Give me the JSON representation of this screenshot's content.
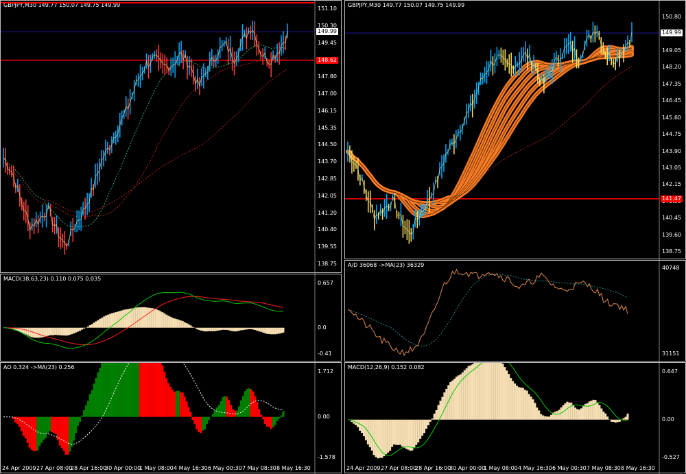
{
  "colors": {
    "background": "#000000",
    "frame": "#c0c0c0",
    "grid": "#303030",
    "price_line": "#1a1aa0",
    "h_line_red": "#ff0000",
    "candle_up": "#00aaff",
    "candle_dn": "#ff4040",
    "orange": "#ff7f27",
    "dashed_red": "#b22222",
    "dashed_green": "#3cb371",
    "bisque": "#f5deb3",
    "ad_line": "#e08a4a",
    "macd_green": "#00c800",
    "macd_red": "#ff2020",
    "ao_up": "#008000",
    "ao_dn": "#ff0000"
  },
  "left": {
    "main": {
      "header": "GBPJPY,M30  149.77 150.07 149.75 149.99",
      "price_axis": [
        "151.10",
        "150.30",
        "149.45",
        "148.65",
        "147.80",
        "147.00",
        "146.15",
        "145.35",
        "144.50",
        "143.70",
        "142.85",
        "142.05",
        "141.20",
        "140.40",
        "139.55",
        "138.75"
      ],
      "current_price_tag": "149.99",
      "red_line_tag": "148.62",
      "top_tag": "151.10"
    },
    "macd": {
      "header": "MACD(38,63,23) 0.110 0.075 0.035",
      "axis": [
        "0.657",
        "0.0",
        "-0.41"
      ]
    },
    "ao": {
      "header": "AO 0.324  ->MA(23) 0.256",
      "axis": [
        "1.712",
        "0.00",
        "-1.578"
      ]
    },
    "x_axis": [
      "24 Apr 2009",
      "27 Apr 08:00",
      "28 Apr 16:00",
      "30 Apr 00:00",
      "1 May 08:00",
      "4 May 16:30",
      "6 May 00:30",
      "7 May 08:30",
      "8 May 16:30"
    ]
  },
  "right": {
    "main": {
      "header": "GBPJPY,M30  149.77 150.07 149.75 149.99",
      "price_axis": [
        "150.80",
        "149.90",
        "149.05",
        "148.20",
        "147.35",
        "146.45",
        "145.60",
        "144.75",
        "143.90",
        "143.05",
        "142.15",
        "141.30",
        "140.45",
        "139.60",
        "138.75"
      ],
      "current_price_tag": "149.99",
      "red_line_tag": "141.47"
    },
    "ad": {
      "header": "A/D 36068  ->MA(23) 36329",
      "axis": [
        "40748",
        "31151"
      ]
    },
    "macd": {
      "header": "MACD(12,26,9) 0.152 0.082",
      "axis": [
        "0.647",
        "0.00",
        "-0.527"
      ]
    },
    "x_axis": [
      "24 Apr 2009",
      "27 Apr 08:00",
      "28 Apr 16:00",
      "30 Apr 00:00",
      "1 May 08:00",
      "4 May 16:30",
      "6 May 00:30",
      "7 May 08:30",
      "8 May 16:30"
    ]
  },
  "chart_data": [
    {
      "type": "line",
      "title": "GBPJPY,M30",
      "x": [
        "24 Apr 2009",
        "27 Apr 08:00",
        "28 Apr 16:00",
        "30 Apr 00:00",
        "1 May 08:00",
        "4 May 16:30",
        "6 May 00:30",
        "7 May 08:30",
        "8 May 16:30"
      ],
      "series": [
        {
          "name": "GBPJPY",
          "values": [
            143.9,
            140.4,
            140.9,
            144.5,
            147.8,
            148.6,
            147.6,
            148.8,
            150.0
          ]
        }
      ],
      "ylim": [
        138.75,
        151.1
      ]
    }
  ]
}
